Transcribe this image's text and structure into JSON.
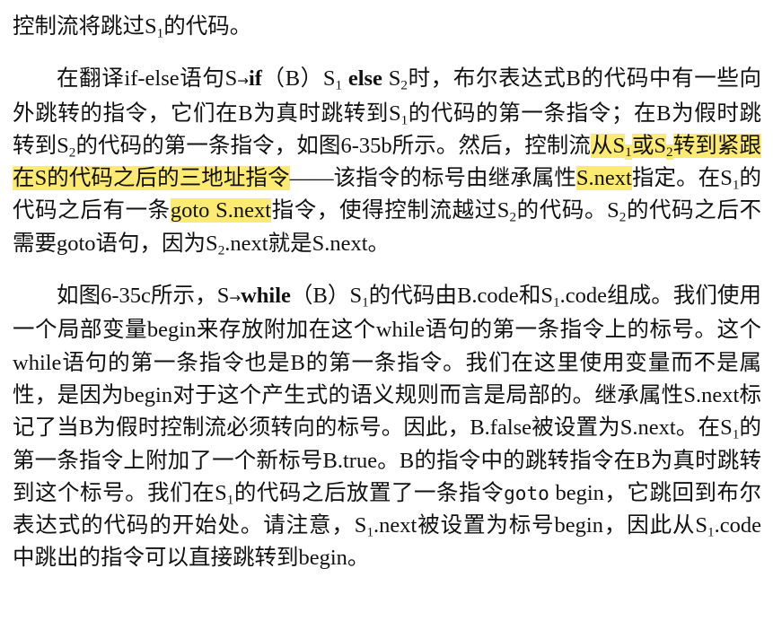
{
  "paragraphs": [
    {
      "segments": [
        {
          "t": "控制流将跳过S"
        },
        {
          "t": "1",
          "sub": true
        },
        {
          "t": "的代码。"
        }
      ]
    },
    {
      "indent": true,
      "segments": [
        {
          "t": "在翻译if-else语句S"
        },
        {
          "t": "→",
          "arrow": true
        },
        {
          "t": "if",
          "b": true
        },
        {
          "t": "（B）S"
        },
        {
          "t": "1",
          "sub": true
        },
        {
          "t": " "
        },
        {
          "t": "else",
          "b": true
        },
        {
          "t": " S"
        },
        {
          "t": "2",
          "sub": true
        },
        {
          "t": "时，布尔表达式B的代码中有一些向外跳转的指令，它们在B为真时跳转到S"
        },
        {
          "t": "1",
          "sub": true
        },
        {
          "t": "的代码的第一条指令；在B为假时跳转到S"
        },
        {
          "t": "2",
          "sub": true
        },
        {
          "t": "的代码的第一条指令，如图6-35b所示。然后，控制流"
        },
        {
          "t": "从S",
          "hl": true
        },
        {
          "t": "1",
          "sub": true,
          "hl": true
        },
        {
          "t": "或S",
          "hl": true
        },
        {
          "t": "2",
          "sub": true,
          "hl": true
        },
        {
          "t": "转到紧跟在S的代码之后的三地址指令",
          "hl": true
        },
        {
          "t": "——该指令的标号由继承属性"
        },
        {
          "t": "S.next",
          "hl": true
        },
        {
          "t": "指定。在S"
        },
        {
          "t": "1",
          "sub": true
        },
        {
          "t": "的代码之后有一条"
        },
        {
          "t": "goto S.next",
          "hl": true
        },
        {
          "t": "指令，使得控制流越过S"
        },
        {
          "t": "2",
          "sub": true
        },
        {
          "t": "的代码。S"
        },
        {
          "t": "2",
          "sub": true
        },
        {
          "t": "的代码之后不需要goto语句，因为S"
        },
        {
          "t": "2",
          "sub": true
        },
        {
          "t": ".next就是S.next。"
        }
      ]
    },
    {
      "indent": true,
      "segments": [
        {
          "t": "如图6-35c所示，S"
        },
        {
          "t": "→",
          "arrow": true
        },
        {
          "t": "while",
          "b": true
        },
        {
          "t": "（B）S"
        },
        {
          "t": "1",
          "sub": true
        },
        {
          "t": "的代码由B.code和S"
        },
        {
          "t": "1",
          "sub": true
        },
        {
          "t": ".code组成。我们使用一个局部变量begin来存放附加在这个while语句的第一条指令上的标号。这个while语句的第一条指令也是B的第一条指令。我们在这里使用变量而不是属性，是因为begin对于这个产生式的语义规则而言是局部的。继承属性S.next标记了当B为假时控制流必须转向的标号。因此，B.false被设置为S.next。在S"
        },
        {
          "t": "1",
          "sub": true
        },
        {
          "t": "的第一条指令上附加了一个新标号B.true。B的指令中的跳转指令在B为真时跳转到这个标号。我们在S"
        },
        {
          "t": "1",
          "sub": true
        },
        {
          "t": "的代码之后放置了一条指令"
        },
        {
          "t": "goto",
          "mono": true
        },
        {
          "t": " begin，它跳回到布尔表达式的代码的开始处。请注意，S"
        },
        {
          "t": "1",
          "sub": true
        },
        {
          "t": ".next被设置为标号begin，因此从S"
        },
        {
          "t": "1",
          "sub": true
        },
        {
          "t": ".code中跳出的指令可以直接跳转到begin。"
        }
      ]
    }
  ]
}
